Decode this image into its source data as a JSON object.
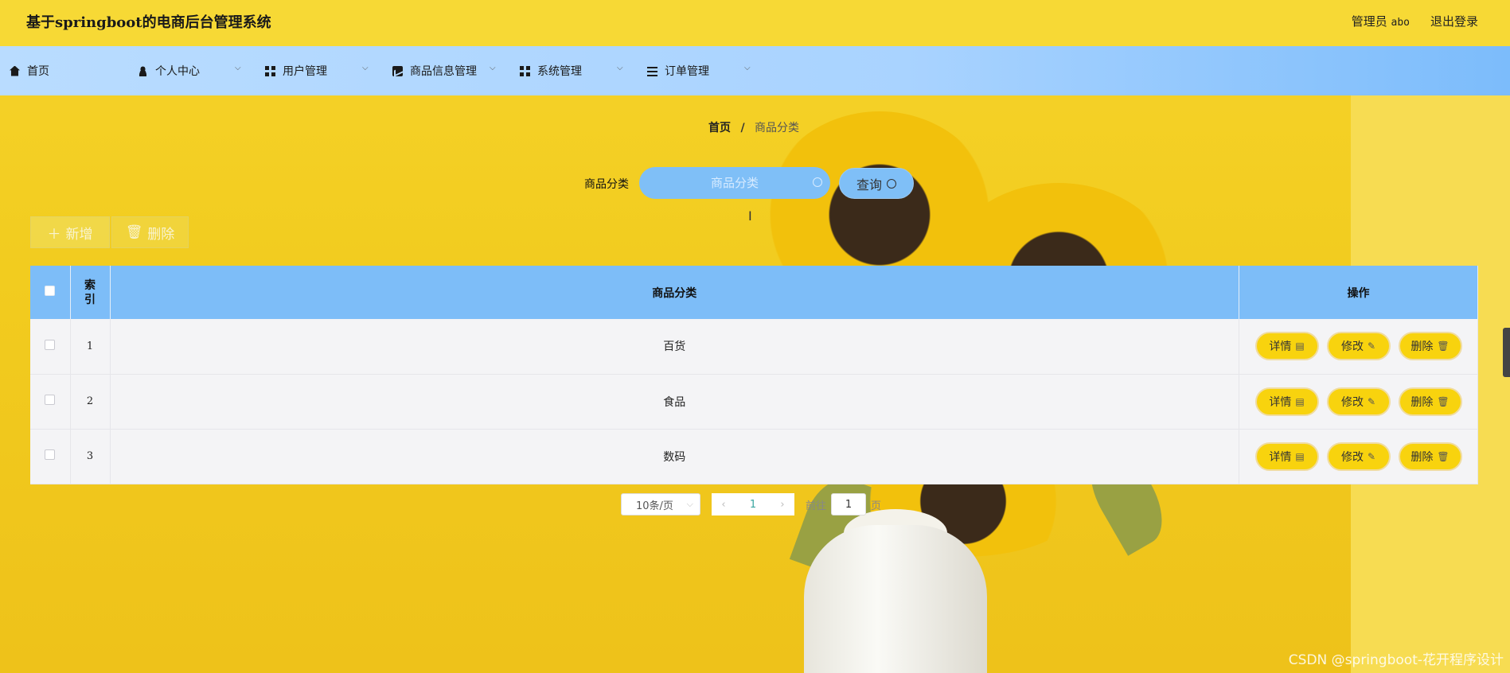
{
  "header": {
    "title": "基于springboot的电商后台管理系统",
    "role_label": "管理员",
    "username": "abo",
    "logout_label": "退出登录"
  },
  "nav": {
    "items": [
      {
        "label": "首页",
        "icon": "home-icon"
      },
      {
        "label": "个人中心",
        "icon": "user-icon"
      },
      {
        "label": "用户管理",
        "icon": "grid-icon"
      },
      {
        "label": "商品信息管理",
        "icon": "chart-icon"
      },
      {
        "label": "系统管理",
        "icon": "grid-icon"
      },
      {
        "label": "订单管理",
        "icon": "list-icon"
      }
    ]
  },
  "breadcrumb": {
    "home": "首页",
    "separator": "/",
    "current": "商品分类"
  },
  "search": {
    "label": "商品分类",
    "placeholder": "商品分类",
    "value": "",
    "button_label": "查询"
  },
  "toolbar": {
    "add_label": "新增",
    "delete_label": "删除"
  },
  "table": {
    "headers": {
      "index": "索引",
      "category": "商品分类",
      "actions": "操作"
    },
    "rows": [
      {
        "index": "1",
        "category": "百货"
      },
      {
        "index": "2",
        "category": "食品"
      },
      {
        "index": "3",
        "category": "数码"
      }
    ],
    "action_labels": {
      "detail": "详情",
      "edit": "修改",
      "delete": "删除"
    }
  },
  "pagination": {
    "page_size": "10条/页",
    "current_page": "1",
    "goto_prefix": "前往",
    "goto_value": "1",
    "goto_suffix": "页"
  },
  "watermark": "CSDN @springboot-花开程序设计",
  "colors": {
    "topbar": "#f7d935",
    "navbar": "#a9d3ff",
    "table_header": "#7dbdf8",
    "action_button": "#f8d30e",
    "search_box": "#7fbff7"
  }
}
